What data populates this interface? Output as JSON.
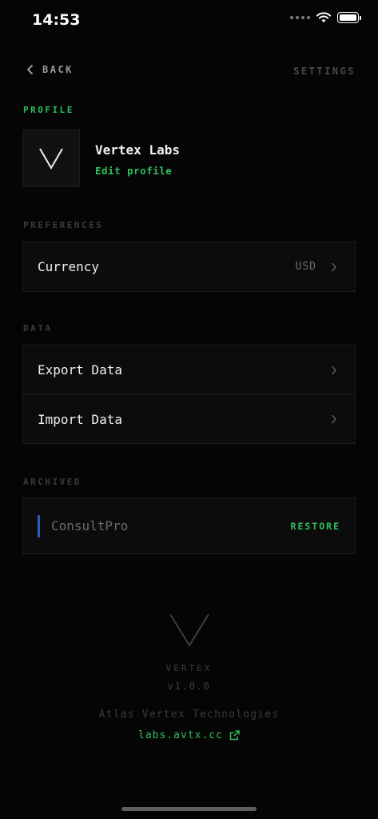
{
  "status_bar": {
    "time": "14:53"
  },
  "nav": {
    "back_label": "BACK",
    "title": "SETTINGS"
  },
  "profile": {
    "section_label": "PROFILE",
    "name": "Vertex Labs",
    "edit_label": "Edit profile"
  },
  "preferences": {
    "section_label": "PREFERENCES",
    "items": [
      {
        "label": "Currency",
        "value": "USD"
      }
    ]
  },
  "data_section": {
    "section_label": "DATA",
    "items": [
      {
        "label": "Export Data"
      },
      {
        "label": "Import Data"
      }
    ]
  },
  "archived": {
    "section_label": "ARCHIVED",
    "items": [
      {
        "name": "ConsultPro",
        "action": "RESTORE",
        "color": "#2b5fb8"
      }
    ]
  },
  "footer": {
    "brand": "VERTEX",
    "version": "v1.0.0",
    "company": "Atlas Vertex Technologies",
    "link": "labs.avtx.cc"
  },
  "colors": {
    "accent": "#2fbf5f",
    "background": "#050505",
    "card": "#0c0c0c",
    "border": "#1e1e1e"
  }
}
